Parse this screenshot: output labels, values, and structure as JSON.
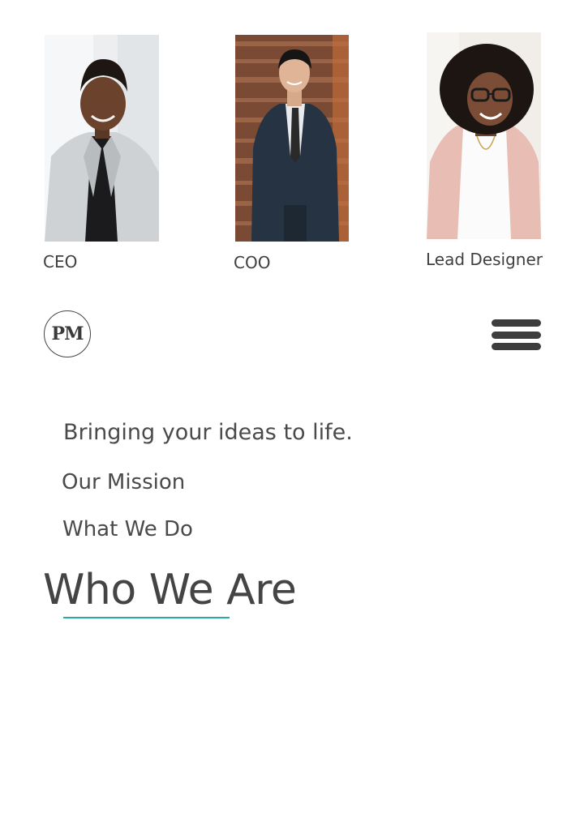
{
  "team": [
    {
      "role": "CEO",
      "photo_icon": "portrait-photo"
    },
    {
      "role": "COO",
      "photo_icon": "portrait-photo"
    },
    {
      "role": "Lead Designer",
      "photo_icon": "portrait-photo"
    }
  ],
  "header": {
    "logo_text": "PM",
    "menu_icon": "hamburger-menu-icon"
  },
  "hero": {
    "tagline": "Bringing your ideas to life."
  },
  "nav": {
    "items": [
      "Our Mission",
      "What We Do",
      "Who We Are"
    ]
  },
  "colors": {
    "text": "#444444",
    "accent": "#2aa9a5",
    "background": "#ffffff"
  }
}
